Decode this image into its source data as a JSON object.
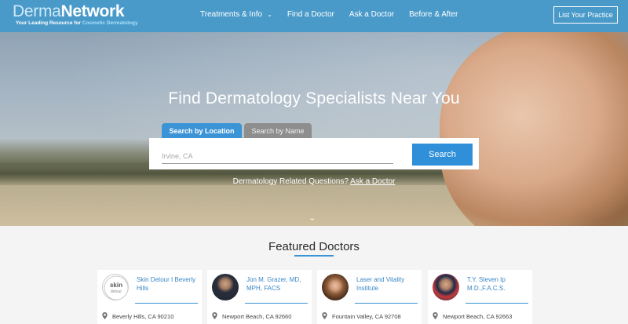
{
  "nav": {
    "logo_prefix": "Derma",
    "logo_suffix": "Network",
    "tagline_prefix": "Your Leading Resource for ",
    "tagline_highlight": "Cosmetic Dermatology",
    "items": [
      {
        "label": "Treatments & Info",
        "has_dropdown": true
      },
      {
        "label": "Find a Doctor"
      },
      {
        "label": "Ask a Doctor"
      },
      {
        "label": "Before & After"
      }
    ],
    "cta": "List Your Practice"
  },
  "hero": {
    "title": "Find Dermatology Specialists Near You",
    "tabs": [
      "Search by Location",
      "Search by Name"
    ],
    "search_placeholder": "Irvine, CA",
    "search_button": "Search",
    "question": "Dermatology Related Questions?",
    "question_link": "Ask a Doctor"
  },
  "featured": {
    "title": "Featured Doctors",
    "cards": [
      {
        "name": "Skin Detour I Beverly Hills",
        "location": "Beverly Hills, CA 90210",
        "photo": "skin-detour-logo"
      },
      {
        "name": "Jon M. Grazer, MD, MPH, FACS",
        "location": "Newport Beach, CA 92660",
        "photo": "doctor-portrait"
      },
      {
        "name": "Laser and Vitality Institute",
        "location": "Fountain Valley, CA 92708",
        "photo": "doctor-portrait"
      },
      {
        "name": "T.Y. Steven Ip M.D.,F.A.C.S.",
        "location": "Newport Beach, CA 92663",
        "photo": "doctor-portrait"
      }
    ],
    "logo_text_1": "skin",
    "logo_text_2": "detour"
  },
  "colors": {
    "nav_bg": "#4a9ac9",
    "accent": "#3b94d6",
    "link": "#3a86c4"
  }
}
